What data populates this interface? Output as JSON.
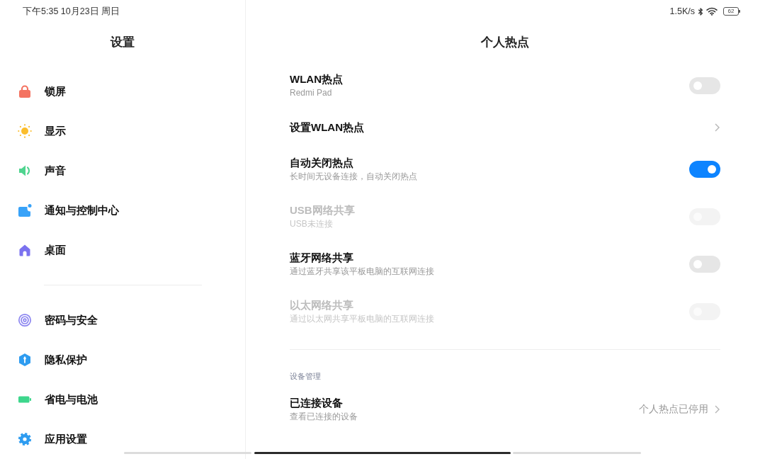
{
  "status_bar": {
    "time": "下午5:35 10月23日 周日",
    "speed": "1.5K/s",
    "battery": "62"
  },
  "sidebar": {
    "title": "设置",
    "groups": [
      {
        "items": [
          {
            "label": "锁屏",
            "selected": false
          },
          {
            "label": "显示",
            "selected": false
          },
          {
            "label": "声音",
            "selected": false
          },
          {
            "label": "通知与控制中心",
            "selected": false
          },
          {
            "label": "桌面",
            "selected": false
          }
        ]
      },
      {
        "items": [
          {
            "label": "密码与安全",
            "selected": false
          },
          {
            "label": "隐私保护",
            "selected": false
          },
          {
            "label": "省电与电池",
            "selected": false
          },
          {
            "label": "应用设置",
            "selected": false
          }
        ]
      }
    ]
  },
  "content": {
    "title": "个人热点",
    "sections": [
      {
        "items": [
          {
            "kind": "toggle",
            "title": "WLAN热点",
            "subtitle": "Redmi Pad",
            "on": false,
            "disabled": false
          },
          {
            "kind": "link",
            "title": "设置WLAN热点",
            "disabled": false
          },
          {
            "kind": "toggle",
            "title": "自动关闭热点",
            "subtitle": "长时间无设备连接，自动关闭热点",
            "on": true,
            "disabled": false
          },
          {
            "kind": "toggle",
            "title": "USB网络共享",
            "subtitle": "USB未连接",
            "on": false,
            "disabled": true
          },
          {
            "kind": "toggle",
            "title": "蓝牙网络共享",
            "subtitle": "通过蓝牙共享该平板电脑的互联网连接",
            "on": false,
            "disabled": false
          },
          {
            "kind": "toggle",
            "title": "以太网络共享",
            "subtitle": "通过以太网共享平板电脑的互联网连接",
            "on": false,
            "disabled": true
          }
        ]
      },
      {
        "header": "设备管理",
        "items": [
          {
            "kind": "link",
            "title": "已连接设备",
            "subtitle": "查看已连接的设备",
            "value": "个人热点已停用",
            "disabled": false
          }
        ]
      }
    ]
  }
}
